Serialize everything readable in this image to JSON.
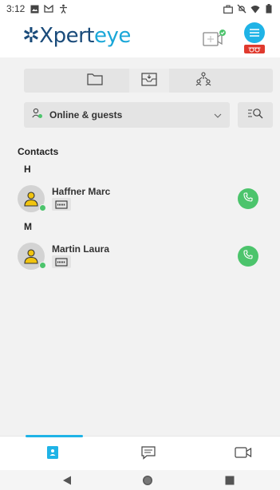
{
  "status_bar": {
    "time": "3:12",
    "left_icons": [
      "image-icon",
      "gmail-icon",
      "accessibility-icon"
    ],
    "right_icons": [
      "briefcase-icon",
      "mute-icon",
      "wifi-icon",
      "battery-icon"
    ]
  },
  "header": {
    "logo_x": "✲X",
    "logo_pert": "pert",
    "logo_eye": "eye",
    "icons": [
      "video-call-icon",
      "menu-icon",
      "smart-glasses-icon"
    ]
  },
  "tabs": [
    {
      "icon": "folder-icon",
      "selected": false
    },
    {
      "icon": "inbox-mail-icon",
      "selected": true
    },
    {
      "icon": "group-hierarchy-icon",
      "selected": false
    }
  ],
  "filter": {
    "label": "Online & guests",
    "icon": "user-status-icon"
  },
  "contacts_section": {
    "title": "Contacts",
    "groups": [
      {
        "letter": "H",
        "contacts": [
          {
            "name": "Haffner Marc",
            "status": "online"
          }
        ]
      },
      {
        "letter": "M",
        "contacts": [
          {
            "name": "Martin Laura",
            "status": "online"
          }
        ]
      }
    ]
  },
  "bottom_nav": {
    "items": [
      {
        "icon": "contacts-book-icon",
        "active": true
      },
      {
        "icon": "chat-icon",
        "active": false
      },
      {
        "icon": "video-icon",
        "active": false
      }
    ]
  },
  "colors": {
    "accent": "#1fb3e6",
    "online": "#4cc46c",
    "brand_dark": "#1a4b7a",
    "glasses_red": "#e03a2e"
  }
}
